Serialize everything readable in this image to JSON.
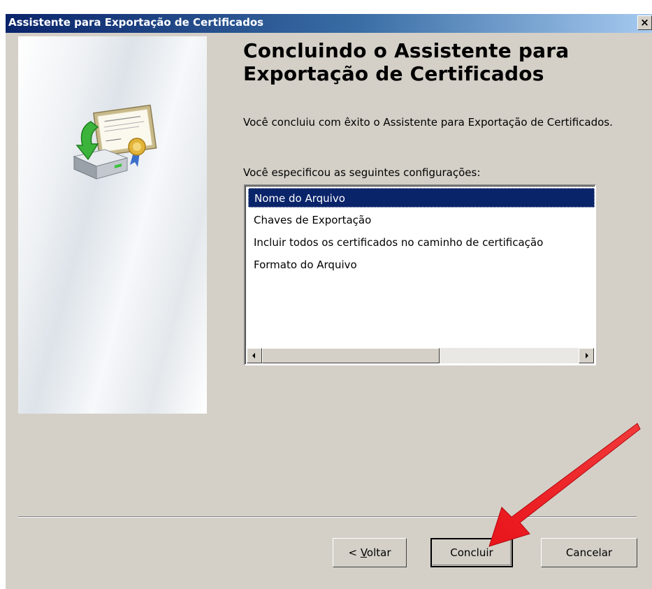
{
  "window": {
    "title": "Assistente para Exportação de Certificados",
    "close_glyph": "×"
  },
  "wizard": {
    "heading": "Concluindo o Assistente para Exportação de Certificados",
    "description": "Você concluiu com êxito o Assistente para Exportação de Certificados.",
    "settings_label": "Você especificou as seguintes configurações:",
    "settings": [
      {
        "label": "Nome do Arquivo",
        "selected": true
      },
      {
        "label": "Chaves de Exportação",
        "selected": false
      },
      {
        "label": "Incluir todos os certificados no caminho de certificação",
        "selected": false
      },
      {
        "label": "Formato do Arquivo",
        "selected": false
      }
    ],
    "icon": "certificate-export-icon"
  },
  "buttons": {
    "back_prefix": "< ",
    "back_accel": "V",
    "back_rest": "oltar",
    "finish": "Concluir",
    "cancel": "Cancelar"
  },
  "annotation": {
    "arrow_color": "#e8141b",
    "points_to": "Concluir"
  }
}
